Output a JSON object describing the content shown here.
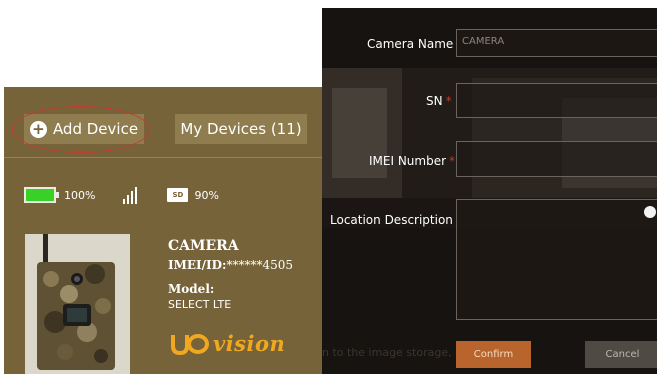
{
  "toolbar": {
    "add_device_label": "Add Device",
    "my_devices_label": "My Devices (11)"
  },
  "status": {
    "battery_text": "100%",
    "battery_level": 1.0,
    "sd_badge": "SD",
    "sd_text": "90%"
  },
  "device": {
    "name": "CAMERA",
    "imei_label": "IMEI/ID:",
    "imei_value": "******4505",
    "model_label": "Model:",
    "model_value": "SELECT LTE"
  },
  "brand": {
    "logo_text": "UOVision",
    "wordmark": "vision"
  },
  "form": {
    "camera_name_label": "Camera Name",
    "camera_name_value": "CAMERA",
    "sn_label": "SN",
    "imei_number_label": "IMEI Number",
    "location_label": "Location Description",
    "required_mark": "*",
    "confirm_label": "Confirm",
    "cancel_label": "Cancel",
    "footer_hint": "n to the image storage,"
  },
  "colors": {
    "panel_brown": "#766339",
    "button_brown": "#8f7d4f",
    "highlight_oval": "#c63a2a",
    "battery_green": "#39d028",
    "confirm_orange": "#b8642c",
    "form_bg": "#171310",
    "required_red": "#c13a29"
  }
}
